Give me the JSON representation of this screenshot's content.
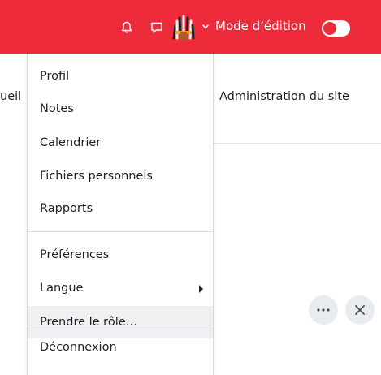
{
  "navbar": {
    "edit_mode_label": "Mode d’édition",
    "icons": [
      "bell-icon",
      "chat-icon",
      "avatar",
      "chevron-down-icon"
    ],
    "accent": "#ee2b3b",
    "edit_mode_on": false
  },
  "secondary_nav": {
    "left_fragment": "ueil",
    "admin": "Administration du site"
  },
  "user_menu": {
    "items": [
      {
        "label": "Profil"
      },
      {
        "label": "Notes"
      },
      {
        "label": "Calendrier"
      },
      {
        "label": "Fichiers personnels"
      },
      {
        "label": "Rapports"
      },
      {
        "label": "Préférences"
      },
      {
        "label": "Langue"
      },
      {
        "label": "Prendre le rôle…"
      },
      {
        "label": "Déconnexion"
      }
    ]
  },
  "actions": {
    "more_icon": "more-icon",
    "close_icon": "close-icon"
  }
}
